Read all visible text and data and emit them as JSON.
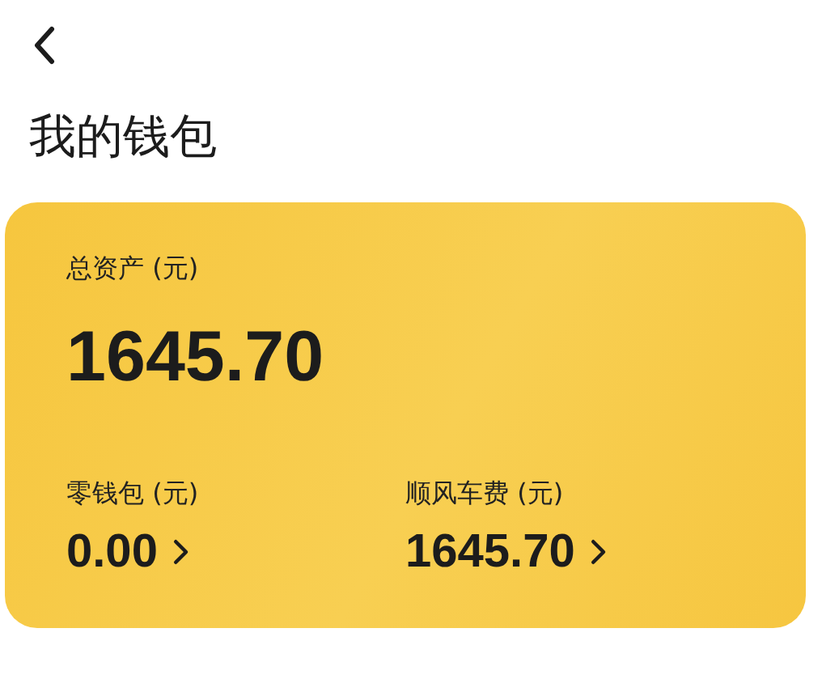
{
  "header": {
    "title": "我的钱包"
  },
  "card": {
    "total": {
      "label": "总资产 (元)",
      "value": "1645.70"
    },
    "accounts": [
      {
        "label": "零钱包 (元)",
        "value": "0.00"
      },
      {
        "label": "顺风车费 (元)",
        "value": "1645.70"
      }
    ]
  }
}
